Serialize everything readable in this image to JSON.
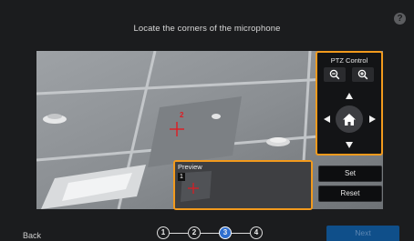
{
  "header": {
    "title": "Locate the corners of the microphone",
    "help_icon": "question-icon",
    "help_glyph": "?"
  },
  "ptz": {
    "title": "PTZ Control",
    "zoom_out_icon": "zoom-out-icon",
    "zoom_in_icon": "zoom-in-icon",
    "up_icon": "arrow-up-icon",
    "down_icon": "arrow-down-icon",
    "left_icon": "arrow-left-icon",
    "right_icon": "arrow-right-icon",
    "home_icon": "home-icon",
    "accent_color": "#f29a1d"
  },
  "camera": {
    "marker_label": "2",
    "marker_color": "#e01b22"
  },
  "preview": {
    "label": "Preview",
    "badge": "1"
  },
  "actions": {
    "set_label": "Set",
    "reset_label": "Reset"
  },
  "footer": {
    "back_label": "Back",
    "next_label": "Next",
    "steps": [
      "1",
      "2",
      "3",
      "4"
    ],
    "active_step": "3"
  }
}
